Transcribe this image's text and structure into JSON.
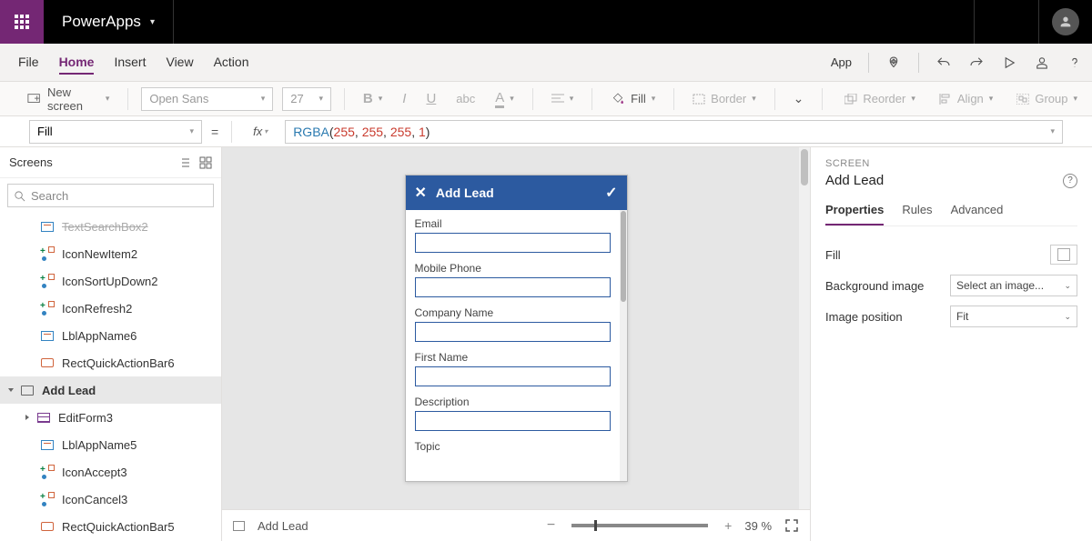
{
  "brand": "PowerApps",
  "menubar": {
    "items": [
      "File",
      "Home",
      "Insert",
      "View",
      "Action"
    ],
    "active": "Home",
    "app_label": "App"
  },
  "ribbon": {
    "new_screen": "New screen",
    "font": "Open Sans",
    "size": "27",
    "fill_label": "Fill",
    "border_label": "Border",
    "reorder_label": "Reorder",
    "align_label": "Align",
    "group_label": "Group"
  },
  "formula": {
    "property": "Fill",
    "fx": "fx",
    "fn": "RGBA",
    "args": [
      "255",
      "255",
      "255",
      "1"
    ]
  },
  "tree": {
    "title": "Screens",
    "search_placeholder": "Search",
    "items": [
      {
        "label": "TextSearchBox2",
        "icon": "label",
        "level": 3,
        "cut": true
      },
      {
        "label": "IconNewItem2",
        "icon": "multi",
        "level": 3
      },
      {
        "label": "IconSortUpDown2",
        "icon": "multi",
        "level": 3
      },
      {
        "label": "IconRefresh2",
        "icon": "multi",
        "level": 3
      },
      {
        "label": "LblAppName6",
        "icon": "label",
        "level": 3
      },
      {
        "label": "RectQuickActionBar6",
        "icon": "rect",
        "level": 3
      },
      {
        "label": "Add Lead",
        "icon": "screen",
        "level": 1,
        "selected": true,
        "chev": "down"
      },
      {
        "label": "EditForm3",
        "icon": "form",
        "level": 2,
        "chev": "right"
      },
      {
        "label": "LblAppName5",
        "icon": "label",
        "level": 3
      },
      {
        "label": "IconAccept3",
        "icon": "multi",
        "level": 3
      },
      {
        "label": "IconCancel3",
        "icon": "multi",
        "level": 3
      },
      {
        "label": "RectQuickActionBar5",
        "icon": "rect",
        "level": 3
      }
    ]
  },
  "preview": {
    "header": "Add Lead",
    "fields": [
      "Email",
      "Mobile Phone",
      "Company Name",
      "First Name",
      "Description",
      "Topic"
    ]
  },
  "status": {
    "screen": "Add Lead",
    "zoom": "39",
    "pct": "%"
  },
  "rightpanel": {
    "section": "SCREEN",
    "title": "Add Lead",
    "tabs": [
      "Properties",
      "Rules",
      "Advanced"
    ],
    "active_tab": "Properties",
    "props": {
      "fill": "Fill",
      "bg": "Background image",
      "bg_value": "Select an image...",
      "pos": "Image position",
      "pos_value": "Fit"
    }
  }
}
